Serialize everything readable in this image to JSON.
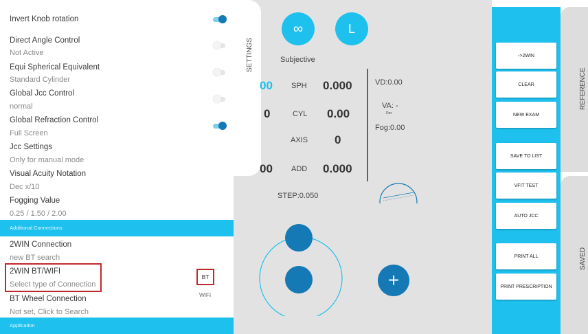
{
  "settings": {
    "items": [
      {
        "title": "Invert Knob rotation",
        "sub": "",
        "toggle": "on"
      },
      {
        "title": "Direct Angle Control",
        "sub": "Not Active",
        "toggle": "off"
      },
      {
        "title": "Equi Spherical Equivalent",
        "sub": "Standard Cylinder",
        "toggle": "off"
      },
      {
        "title": "Global Jcc Control",
        "sub": "normal",
        "toggle": "off"
      },
      {
        "title": "Global Refraction Control",
        "sub": "Full Screen",
        "toggle": "on"
      },
      {
        "title": "Jcc Settings",
        "sub": "Only for manual mode"
      },
      {
        "title": "Visual Acuity Notation",
        "sub": "Dec x/10"
      },
      {
        "title": "Fogging Value",
        "sub": "0.25 / 1.50 / 2.00"
      }
    ],
    "section_additional": "Additional Connections",
    "connections": [
      {
        "title": "2WIN Connection",
        "sub": "new BT search"
      },
      {
        "title": "2WIN BT/WIFI",
        "sub": "Select type of Connection"
      },
      {
        "title": "BT Wheel Connection",
        "sub": "Not set, Click to Search"
      }
    ],
    "bt_option": "BT",
    "wifi_option": "WiFi",
    "section_application": "Application",
    "tab_label": "SETTINGS"
  },
  "main": {
    "infinity_symbol": "∞",
    "eye_letter": "L",
    "mode_label": "Subjective",
    "rows": [
      {
        "left": "00",
        "label": "SPH",
        "value": "0.000"
      },
      {
        "left": "0",
        "label": "CYL",
        "value": "0.00"
      },
      {
        "left": "",
        "label": "AXIS",
        "value": "0"
      },
      {
        "left": "00",
        "label": "ADD",
        "value": "0.000"
      }
    ],
    "vd": "VD:0.00",
    "va": "VA: -",
    "va_sub": "Dec",
    "fog": "Fog:0.00",
    "step": "STEP:0.050",
    "plus_symbol": "+"
  },
  "buttons": [
    "->2WIN",
    "CLEAR",
    "NEW EXAM",
    "SAVE TO LIST",
    "VFIT TEST",
    "AUTO JCC",
    "PRINT ALL",
    "PRINT PRESCRIPTION"
  ],
  "side_labels": {
    "reference": "REFERENCE",
    "saved": "SAVED"
  },
  "colors": {
    "accent": "#1ec0ee",
    "dark_blue": "#1479b4",
    "highlight": "#c0272d",
    "panel_grey": "#e2e2e2"
  }
}
